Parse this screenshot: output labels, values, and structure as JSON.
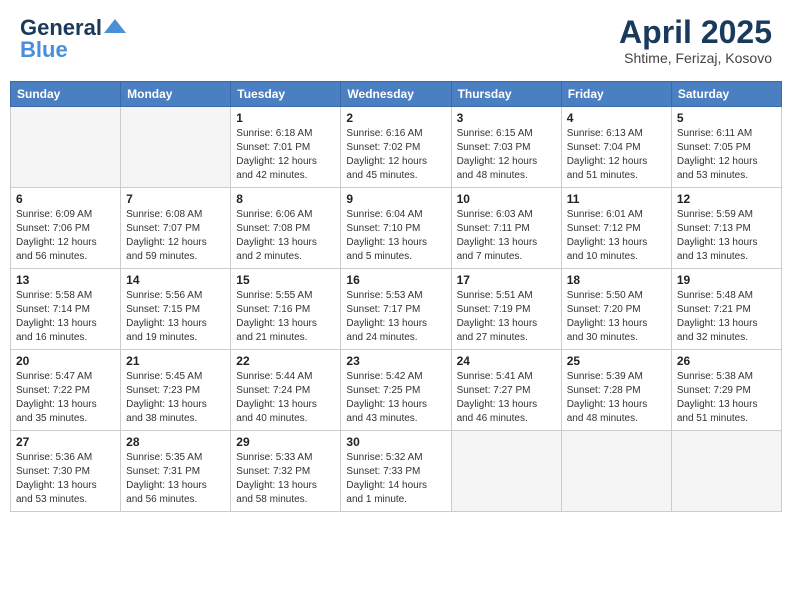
{
  "header": {
    "logo_general": "General",
    "logo_blue": "Blue",
    "month_year": "April 2025",
    "location": "Shtime, Ferizaj, Kosovo"
  },
  "days_of_week": [
    "Sunday",
    "Monday",
    "Tuesday",
    "Wednesday",
    "Thursday",
    "Friday",
    "Saturday"
  ],
  "weeks": [
    [
      {
        "day": "",
        "info": ""
      },
      {
        "day": "",
        "info": ""
      },
      {
        "day": "1",
        "info": "Sunrise: 6:18 AM\nSunset: 7:01 PM\nDaylight: 12 hours and 42 minutes."
      },
      {
        "day": "2",
        "info": "Sunrise: 6:16 AM\nSunset: 7:02 PM\nDaylight: 12 hours and 45 minutes."
      },
      {
        "day": "3",
        "info": "Sunrise: 6:15 AM\nSunset: 7:03 PM\nDaylight: 12 hours and 48 minutes."
      },
      {
        "day": "4",
        "info": "Sunrise: 6:13 AM\nSunset: 7:04 PM\nDaylight: 12 hours and 51 minutes."
      },
      {
        "day": "5",
        "info": "Sunrise: 6:11 AM\nSunset: 7:05 PM\nDaylight: 12 hours and 53 minutes."
      }
    ],
    [
      {
        "day": "6",
        "info": "Sunrise: 6:09 AM\nSunset: 7:06 PM\nDaylight: 12 hours and 56 minutes."
      },
      {
        "day": "7",
        "info": "Sunrise: 6:08 AM\nSunset: 7:07 PM\nDaylight: 12 hours and 59 minutes."
      },
      {
        "day": "8",
        "info": "Sunrise: 6:06 AM\nSunset: 7:08 PM\nDaylight: 13 hours and 2 minutes."
      },
      {
        "day": "9",
        "info": "Sunrise: 6:04 AM\nSunset: 7:10 PM\nDaylight: 13 hours and 5 minutes."
      },
      {
        "day": "10",
        "info": "Sunrise: 6:03 AM\nSunset: 7:11 PM\nDaylight: 13 hours and 7 minutes."
      },
      {
        "day": "11",
        "info": "Sunrise: 6:01 AM\nSunset: 7:12 PM\nDaylight: 13 hours and 10 minutes."
      },
      {
        "day": "12",
        "info": "Sunrise: 5:59 AM\nSunset: 7:13 PM\nDaylight: 13 hours and 13 minutes."
      }
    ],
    [
      {
        "day": "13",
        "info": "Sunrise: 5:58 AM\nSunset: 7:14 PM\nDaylight: 13 hours and 16 minutes."
      },
      {
        "day": "14",
        "info": "Sunrise: 5:56 AM\nSunset: 7:15 PM\nDaylight: 13 hours and 19 minutes."
      },
      {
        "day": "15",
        "info": "Sunrise: 5:55 AM\nSunset: 7:16 PM\nDaylight: 13 hours and 21 minutes."
      },
      {
        "day": "16",
        "info": "Sunrise: 5:53 AM\nSunset: 7:17 PM\nDaylight: 13 hours and 24 minutes."
      },
      {
        "day": "17",
        "info": "Sunrise: 5:51 AM\nSunset: 7:19 PM\nDaylight: 13 hours and 27 minutes."
      },
      {
        "day": "18",
        "info": "Sunrise: 5:50 AM\nSunset: 7:20 PM\nDaylight: 13 hours and 30 minutes."
      },
      {
        "day": "19",
        "info": "Sunrise: 5:48 AM\nSunset: 7:21 PM\nDaylight: 13 hours and 32 minutes."
      }
    ],
    [
      {
        "day": "20",
        "info": "Sunrise: 5:47 AM\nSunset: 7:22 PM\nDaylight: 13 hours and 35 minutes."
      },
      {
        "day": "21",
        "info": "Sunrise: 5:45 AM\nSunset: 7:23 PM\nDaylight: 13 hours and 38 minutes."
      },
      {
        "day": "22",
        "info": "Sunrise: 5:44 AM\nSunset: 7:24 PM\nDaylight: 13 hours and 40 minutes."
      },
      {
        "day": "23",
        "info": "Sunrise: 5:42 AM\nSunset: 7:25 PM\nDaylight: 13 hours and 43 minutes."
      },
      {
        "day": "24",
        "info": "Sunrise: 5:41 AM\nSunset: 7:27 PM\nDaylight: 13 hours and 46 minutes."
      },
      {
        "day": "25",
        "info": "Sunrise: 5:39 AM\nSunset: 7:28 PM\nDaylight: 13 hours and 48 minutes."
      },
      {
        "day": "26",
        "info": "Sunrise: 5:38 AM\nSunset: 7:29 PM\nDaylight: 13 hours and 51 minutes."
      }
    ],
    [
      {
        "day": "27",
        "info": "Sunrise: 5:36 AM\nSunset: 7:30 PM\nDaylight: 13 hours and 53 minutes."
      },
      {
        "day": "28",
        "info": "Sunrise: 5:35 AM\nSunset: 7:31 PM\nDaylight: 13 hours and 56 minutes."
      },
      {
        "day": "29",
        "info": "Sunrise: 5:33 AM\nSunset: 7:32 PM\nDaylight: 13 hours and 58 minutes."
      },
      {
        "day": "30",
        "info": "Sunrise: 5:32 AM\nSunset: 7:33 PM\nDaylight: 14 hours and 1 minute."
      },
      {
        "day": "",
        "info": ""
      },
      {
        "day": "",
        "info": ""
      },
      {
        "day": "",
        "info": ""
      }
    ]
  ]
}
